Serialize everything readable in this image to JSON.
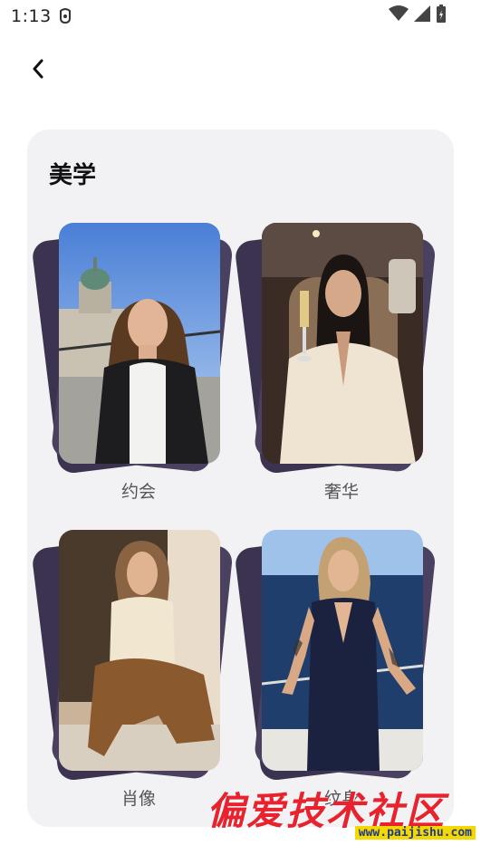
{
  "status_bar": {
    "time": "1:13"
  },
  "section": {
    "title": "美学"
  },
  "tiles": [
    {
      "label": "约会"
    },
    {
      "label": "奢华"
    },
    {
      "label": "肖像"
    },
    {
      "label": "纹身"
    }
  ],
  "watermark": {
    "text": "偏爱技术社区",
    "url": "www.paijishu.com"
  },
  "colors": {
    "card_background": "#f2f1f4",
    "back_card": "#3b3350",
    "label_text": "#555555",
    "watermark_red": "#e8232e"
  }
}
